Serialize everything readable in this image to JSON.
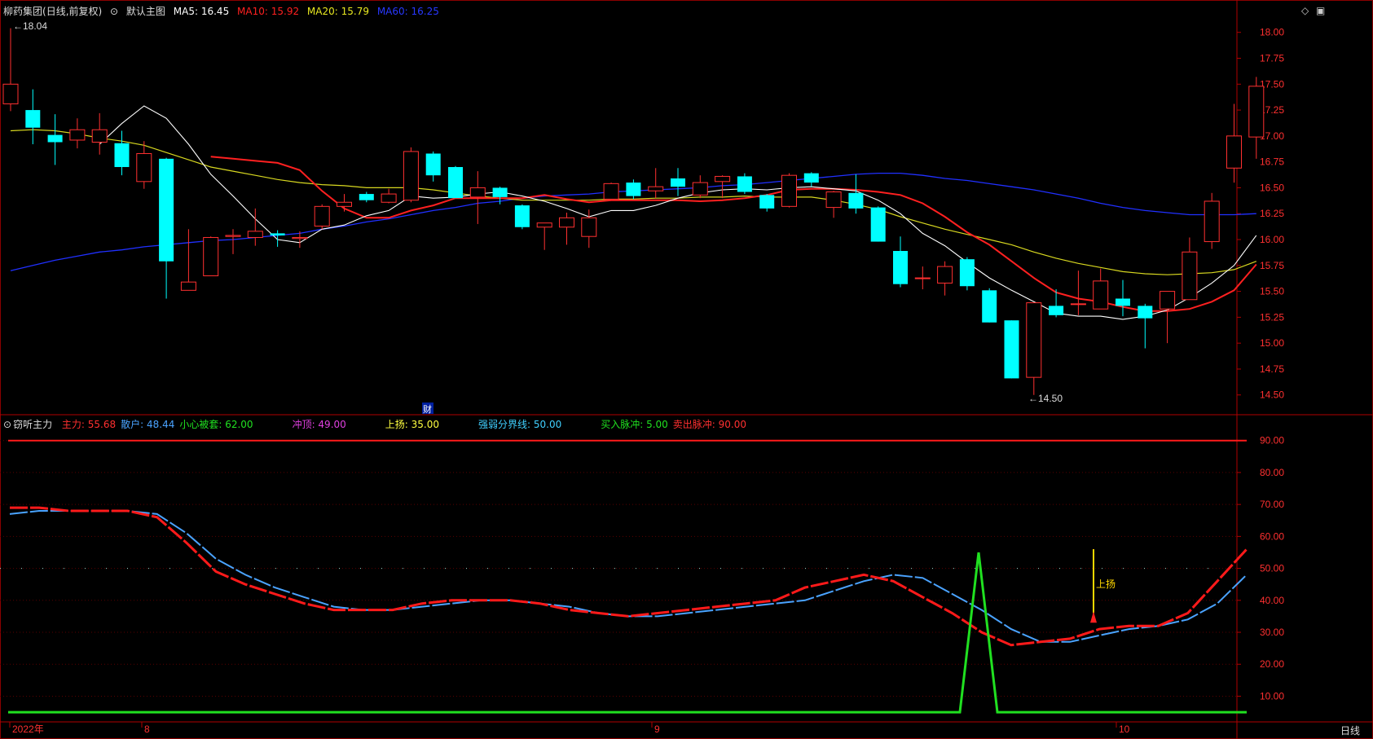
{
  "main_header": {
    "stock_name": "柳药集团",
    "mode": "(日线,前复权)",
    "main_chart_label": "默认主图",
    "ma5": {
      "label": "MA5:",
      "value": "16.45",
      "color": "#ffffff"
    },
    "ma10": {
      "label": "MA10:",
      "value": "15.92",
      "color": "#ff2020"
    },
    "ma20": {
      "label": "MA20:",
      "value": "15.79",
      "color": "#e8e820"
    },
    "ma60": {
      "label": "MA60:",
      "value": "16.25",
      "color": "#2030ff"
    }
  },
  "window_controls": {
    "diamond": "◇",
    "restore": "▣"
  },
  "sub_header": {
    "indicator_name": "窃听主力",
    "items": [
      {
        "label": "主力:",
        "value": "55.68",
        "color": "#ff3030"
      },
      {
        "label": "散户:",
        "value": "48.44",
        "color": "#4aa3ff"
      },
      {
        "label": "小心被套:",
        "value": "62.00",
        "color": "#20e020"
      },
      {
        "label": "冲顶:",
        "value": "49.00",
        "color": "#e040e0"
      },
      {
        "label": "上扬:",
        "value": "35.00",
        "color": "#ffff40"
      },
      {
        "label": "强弱分界线:",
        "value": "50.00",
        "color": "#40d0ff"
      },
      {
        "label": "买入脉冲:",
        "value": "5.00",
        "color": "#20e020"
      },
      {
        "label": "卖出脉冲:",
        "value": "90.00",
        "color": "#ff3030"
      }
    ]
  },
  "timeframe_label": "日线",
  "chart_data": {
    "type": "candlestick",
    "y_ticks": [
      "18.00",
      "17.75",
      "17.50",
      "17.25",
      "17.00",
      "16.75",
      "16.50",
      "16.25",
      "16.00",
      "15.75",
      "15.50",
      "15.25",
      "15.00",
      "14.75",
      "14.50"
    ],
    "ylim": [
      14.38,
      18.1
    ],
    "high_marker": "18.04",
    "low_marker": "14.50",
    "finance_marker": "财",
    "candles": [
      {
        "o": 17.31,
        "h": 18.04,
        "l": 17.24,
        "c": 17.5
      },
      {
        "o": 17.25,
        "h": 17.45,
        "l": 16.92,
        "c": 17.08
      },
      {
        "o": 17.01,
        "h": 17.21,
        "l": 16.72,
        "c": 16.94
      },
      {
        "o": 16.96,
        "h": 17.17,
        "l": 16.88,
        "c": 17.06
      },
      {
        "o": 16.94,
        "h": 17.22,
        "l": 16.82,
        "c": 17.06
      },
      {
        "o": 16.93,
        "h": 17.05,
        "l": 16.62,
        "c": 16.7
      },
      {
        "o": 16.56,
        "h": 16.95,
        "l": 16.49,
        "c": 16.83
      },
      {
        "o": 16.78,
        "h": 16.79,
        "l": 15.43,
        "c": 15.79
      },
      {
        "o": 15.51,
        "h": 16.1,
        "l": 15.51,
        "c": 15.59
      },
      {
        "o": 15.65,
        "h": 16.03,
        "l": 15.65,
        "c": 16.02
      },
      {
        "o": 16.03,
        "h": 16.1,
        "l": 15.86,
        "c": 16.04
      },
      {
        "o": 16.02,
        "h": 16.3,
        "l": 15.94,
        "c": 16.08
      },
      {
        "o": 16.06,
        "h": 16.09,
        "l": 15.93,
        "c": 16.04
      },
      {
        "o": 16.01,
        "h": 16.08,
        "l": 15.92,
        "c": 16.02
      },
      {
        "o": 16.13,
        "h": 16.34,
        "l": 16.1,
        "c": 16.32
      },
      {
        "o": 16.32,
        "h": 16.44,
        "l": 16.27,
        "c": 16.36
      },
      {
        "o": 16.44,
        "h": 16.46,
        "l": 16.36,
        "c": 16.38
      },
      {
        "o": 16.36,
        "h": 16.49,
        "l": 16.35,
        "c": 16.44
      },
      {
        "o": 16.38,
        "h": 16.89,
        "l": 16.36,
        "c": 16.85
      },
      {
        "o": 16.83,
        "h": 16.85,
        "l": 16.56,
        "c": 16.62
      },
      {
        "o": 16.7,
        "h": 16.71,
        "l": 16.41,
        "c": 16.4
      },
      {
        "o": 16.41,
        "h": 16.66,
        "l": 16.15,
        "c": 16.5
      },
      {
        "o": 16.5,
        "h": 16.51,
        "l": 16.34,
        "c": 16.41
      },
      {
        "o": 16.33,
        "h": 16.34,
        "l": 16.1,
        "c": 16.12
      },
      {
        "o": 16.12,
        "h": 16.16,
        "l": 15.9,
        "c": 16.16
      },
      {
        "o": 16.12,
        "h": 16.26,
        "l": 15.95,
        "c": 16.21
      },
      {
        "o": 16.03,
        "h": 16.29,
        "l": 15.92,
        "c": 16.21
      },
      {
        "o": 16.39,
        "h": 16.55,
        "l": 16.39,
        "c": 16.54
      },
      {
        "o": 16.55,
        "h": 16.58,
        "l": 16.39,
        "c": 16.42
      },
      {
        "o": 16.47,
        "h": 16.69,
        "l": 16.4,
        "c": 16.51
      },
      {
        "o": 16.59,
        "h": 16.69,
        "l": 16.42,
        "c": 16.51
      },
      {
        "o": 16.43,
        "h": 16.62,
        "l": 16.4,
        "c": 16.55
      },
      {
        "o": 16.56,
        "h": 16.62,
        "l": 16.4,
        "c": 16.61
      },
      {
        "o": 16.61,
        "h": 16.64,
        "l": 16.44,
        "c": 16.46
      },
      {
        "o": 16.43,
        "h": 16.44,
        "l": 16.27,
        "c": 16.3
      },
      {
        "o": 16.32,
        "h": 16.64,
        "l": 16.31,
        "c": 16.62
      },
      {
        "o": 16.64,
        "h": 16.65,
        "l": 16.51,
        "c": 16.55
      },
      {
        "o": 16.31,
        "h": 16.47,
        "l": 16.21,
        "c": 16.46
      },
      {
        "o": 16.45,
        "h": 16.63,
        "l": 16.25,
        "c": 16.3
      },
      {
        "o": 16.31,
        "h": 16.32,
        "l": 15.98,
        "c": 15.98
      },
      {
        "o": 15.89,
        "h": 16.03,
        "l": 15.54,
        "c": 15.57
      },
      {
        "o": 15.63,
        "h": 15.74,
        "l": 15.52,
        "c": 15.63
      },
      {
        "o": 15.58,
        "h": 15.79,
        "l": 15.46,
        "c": 15.74
      },
      {
        "o": 15.81,
        "h": 15.83,
        "l": 15.51,
        "c": 15.55
      },
      {
        "o": 15.51,
        "h": 15.53,
        "l": 15.2,
        "c": 15.2
      },
      {
        "o": 15.22,
        "h": 15.22,
        "l": 14.66,
        "c": 14.66
      },
      {
        "o": 14.67,
        "h": 15.39,
        "l": 14.5,
        "c": 15.39
      },
      {
        "o": 15.36,
        "h": 15.52,
        "l": 15.25,
        "c": 15.27
      },
      {
        "o": 15.38,
        "h": 15.7,
        "l": 15.27,
        "c": 15.38
      },
      {
        "o": 15.33,
        "h": 15.72,
        "l": 15.33,
        "c": 15.6
      },
      {
        "o": 15.43,
        "h": 15.61,
        "l": 15.26,
        "c": 15.36
      },
      {
        "o": 15.36,
        "h": 15.38,
        "l": 14.95,
        "c": 15.24
      },
      {
        "o": 15.33,
        "h": 15.5,
        "l": 15.0,
        "c": 15.5
      },
      {
        "o": 15.42,
        "h": 16.02,
        "l": 15.42,
        "c": 15.88
      },
      {
        "o": 15.98,
        "h": 16.45,
        "l": 15.91,
        "c": 16.37
      },
      {
        "o": 16.69,
        "h": 17.31,
        "l": 16.55,
        "c": 17.0
      },
      {
        "o": 16.99,
        "h": 17.57,
        "l": 16.78,
        "c": 17.48
      }
    ],
    "ma5": [
      null,
      null,
      null,
      null,
      16.92,
      17.12,
      17.29,
      17.17,
      16.92,
      16.63,
      16.42,
      16.2,
      16.0,
      15.97,
      16.1,
      16.14,
      16.23,
      16.28,
      16.42,
      16.4,
      16.41,
      16.44,
      16.46,
      16.42,
      16.37,
      16.3,
      16.22,
      16.28,
      16.28,
      16.33,
      16.4,
      16.45,
      16.48,
      16.49,
      16.48,
      16.5,
      16.51,
      16.49,
      16.47,
      16.38,
      16.25,
      16.06,
      15.94,
      15.78,
      15.63,
      15.51,
      15.4,
      15.29,
      15.26,
      15.26,
      15.23,
      15.26,
      15.32,
      15.44,
      15.58,
      15.75,
      16.04
    ],
    "ma10": [
      null,
      null,
      null,
      null,
      null,
      null,
      null,
      null,
      null,
      16.8,
      16.78,
      16.76,
      16.74,
      16.67,
      16.47,
      16.3,
      16.21,
      16.21,
      16.28,
      16.33,
      16.4,
      16.4,
      16.4,
      16.4,
      16.43,
      16.39,
      16.36,
      16.38,
      16.38,
      16.38,
      16.38,
      16.37,
      16.38,
      16.4,
      16.43,
      16.48,
      16.49,
      16.49,
      16.48,
      16.46,
      16.43,
      16.35,
      16.22,
      16.07,
      15.95,
      15.79,
      15.63,
      15.49,
      15.43,
      15.4,
      15.35,
      15.31,
      15.31,
      15.33,
      15.4,
      15.51,
      15.76
    ],
    "ma20": [
      17.05,
      17.06,
      17.05,
      17.02,
      16.98,
      16.95,
      16.91,
      16.84,
      16.77,
      16.7,
      16.66,
      16.62,
      16.58,
      16.55,
      16.53,
      16.52,
      16.5,
      16.5,
      16.5,
      16.48,
      16.45,
      16.42,
      16.4,
      16.38,
      16.38,
      16.38,
      16.38,
      16.39,
      16.39,
      16.4,
      16.4,
      16.41,
      16.41,
      16.42,
      16.41,
      16.41,
      16.41,
      16.38,
      16.34,
      16.29,
      16.22,
      16.16,
      16.1,
      16.05,
      16.0,
      15.95,
      15.88,
      15.82,
      15.77,
      15.73,
      15.69,
      15.67,
      15.66,
      15.67,
      15.68,
      15.71,
      15.79
    ],
    "ma60": [
      15.7,
      15.75,
      15.8,
      15.84,
      15.88,
      15.9,
      15.93,
      15.95,
      15.97,
      15.99,
      16.0,
      16.02,
      16.04,
      16.06,
      16.1,
      16.13,
      16.17,
      16.2,
      16.24,
      16.28,
      16.31,
      16.35,
      16.37,
      16.4,
      16.42,
      16.43,
      16.44,
      16.46,
      16.47,
      16.48,
      16.49,
      16.5,
      16.52,
      16.53,
      16.55,
      16.57,
      16.59,
      16.61,
      16.63,
      16.64,
      16.64,
      16.62,
      16.59,
      16.57,
      16.54,
      16.51,
      16.48,
      16.44,
      16.4,
      16.35,
      16.31,
      16.28,
      16.26,
      16.24,
      16.24,
      16.24,
      16.25
    ],
    "sub_chart": {
      "y_ticks": [
        "90.00",
        "80.00",
        "70.00",
        "60.00",
        "50.00",
        "40.00",
        "30.00",
        "20.00",
        "10.00"
      ],
      "ylim": [
        4,
        94
      ],
      "sell_pulse": 90,
      "divider": 50,
      "main_force": [
        69,
        69,
        68,
        68,
        68,
        66,
        58,
        49,
        45,
        42,
        39,
        37,
        37,
        37,
        39,
        40,
        40,
        40,
        39,
        37,
        36,
        35,
        36,
        37,
        38,
        39,
        40,
        44,
        46,
        48,
        46,
        41,
        36,
        30,
        26,
        27,
        28,
        31,
        32,
        32,
        36,
        46,
        56
      ],
      "retail": [
        67,
        68,
        68,
        68,
        68,
        67,
        61,
        53,
        48,
        44,
        41,
        38,
        37,
        37,
        38,
        39,
        40,
        40,
        39,
        38,
        36,
        35,
        35,
        36,
        37,
        38,
        39,
        40,
        43,
        46,
        48,
        47,
        42,
        37,
        31,
        27,
        27,
        29,
        31,
        32,
        34,
        39,
        48
      ],
      "pulse": [
        {
          "x": 1178,
          "v": 5
        },
        {
          "x": 1201,
          "v": 55
        },
        {
          "x": 1224,
          "v": 5
        }
      ],
      "rise_signal": {
        "label": "上扬",
        "value": 35
      }
    },
    "x_labels": [
      "2022年",
      "8",
      "9",
      "10"
    ]
  }
}
